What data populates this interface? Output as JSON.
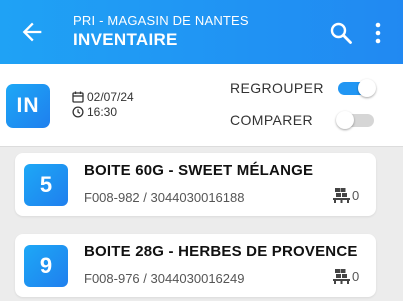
{
  "appbar": {
    "subtitle": "PRI - MAGASIN DE NANTES",
    "title": "INVENTAIRE",
    "background": "#1f95f4"
  },
  "header": {
    "badge": "IN",
    "date": "02/07/24",
    "time": "16:30",
    "regrouper_label": "REGROUPER",
    "regrouper_on": true,
    "comparer_label": "COMPARER",
    "comparer_on": false
  },
  "items": [
    {
      "number": "5",
      "name": "BOITE 60G - SWEET MÉLANGE",
      "code": "F008-982 / 3044030016188",
      "quantity": "0"
    },
    {
      "number": "9",
      "name": "BOITE 28G - HERBES DE PROVENCE",
      "code": "F008-976 / 3044030016249",
      "quantity": "0"
    }
  ],
  "icons": [
    "back-arrow-icon",
    "search-icon",
    "more-vert-icon",
    "calendar-icon",
    "clock-icon",
    "pallet-icon"
  ],
  "accent": "#2196f3"
}
